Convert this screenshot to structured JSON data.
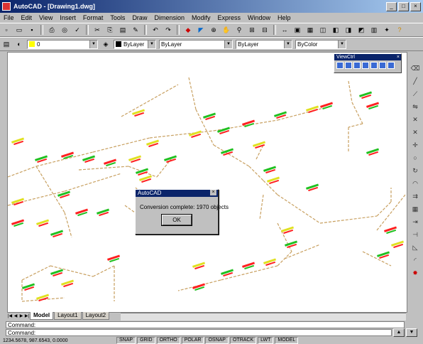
{
  "window": {
    "title": "AutoCAD - [Drawing1.dwg]",
    "min": "_",
    "max": "□",
    "close": "×"
  },
  "menu": [
    "File",
    "Edit",
    "View",
    "Insert",
    "Format",
    "Tools",
    "Draw",
    "Dimension",
    "Modify",
    "Express",
    "Window",
    "Help"
  ],
  "toolbar1": {
    "icons": [
      "new-icon",
      "open-icon",
      "save-icon",
      "print-icon",
      "preview-icon",
      "cut-icon",
      "copy-icon",
      "paste-icon",
      "match-icon",
      "undo-icon",
      "redo-icon",
      "hyperlink-icon",
      "snap-icon",
      "ucs-icon",
      "pan-icon",
      "zoom-icon",
      "zoom-window-icon",
      "zoom-prev-icon",
      "distance-icon",
      "properties-icon",
      "design-center-icon",
      "help-icon"
    ]
  },
  "toolbar2": {
    "layer_value": "0",
    "color_value": "ByLayer",
    "linetype_value": "ByLayer",
    "lineweight_value": "ByLayer",
    "plotstyle_value": "ByColor"
  },
  "floating_toolbar": {
    "title": "ViewCtrl"
  },
  "dialog": {
    "title": "AutoCAD",
    "message": "Conversion complete: 1970 objects",
    "ok_label": "OK"
  },
  "layout_tabs": [
    "Model",
    "Layout1",
    "Layout2"
  ],
  "command_lines": [
    "Command:",
    "Command:"
  ],
  "status": {
    "coords": "1234.5678, 987.6543, 0.0000",
    "modes": [
      "SNAP",
      "GRID",
      "ORTHO",
      "POLAR",
      "OSNAP",
      "OTRACK",
      "LWT",
      "MODEL"
    ]
  },
  "colors": {
    "line": "#c8a060",
    "label_red": "#ff2020",
    "label_green": "#20c020",
    "label_yellow": "#e0e020"
  }
}
